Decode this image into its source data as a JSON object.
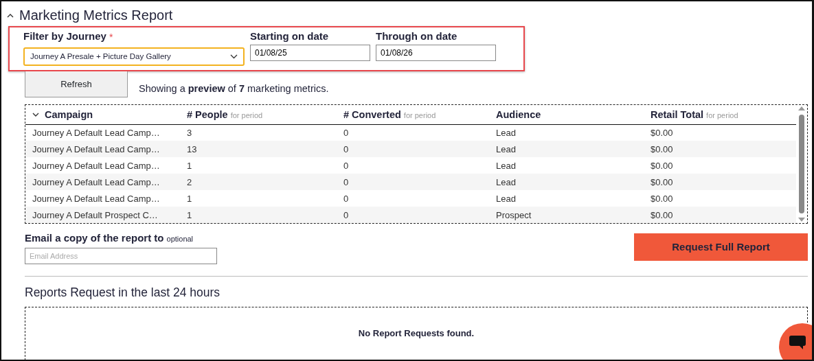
{
  "title": "Marketing Metrics Report",
  "filters": {
    "journey": {
      "label": "Filter by Journey",
      "required_mark": "*",
      "value": "Journey A Presale + Picture Day Gallery"
    },
    "start": {
      "label": "Starting on date",
      "value": "01/08/25"
    },
    "through": {
      "label": "Through on date",
      "value": "01/08/26"
    }
  },
  "refresh_button": "Refresh",
  "preview_text": "Showing a **preview** of **7** marketing metrics.",
  "table": {
    "columns": [
      {
        "label": "Campaign"
      },
      {
        "label": "# People",
        "note": "for period"
      },
      {
        "label": "# Converted",
        "note": "for period"
      },
      {
        "label": "Audience"
      },
      {
        "label": "Retail Total",
        "note": "for period"
      }
    ],
    "rows": [
      [
        "Journey A Default Lead Camp…",
        "3",
        "0",
        "Lead",
        "$0.00"
      ],
      [
        "Journey A Default Lead Camp…",
        "13",
        "0",
        "Lead",
        "$0.00"
      ],
      [
        "Journey A Default Lead Camp…",
        "1",
        "0",
        "Lead",
        "$0.00"
      ],
      [
        "Journey A Default Lead Camp…",
        "2",
        "0",
        "Lead",
        "$0.00"
      ],
      [
        "Journey A Default Lead Camp…",
        "1",
        "0",
        "Lead",
        "$0.00"
      ],
      [
        "Journey A Default Prospect C…",
        "1",
        "0",
        "Prospect",
        "$0.00"
      ]
    ]
  },
  "email": {
    "label": "Email a copy of the report to",
    "note": "optional",
    "placeholder": "Email Address"
  },
  "request_button": "Request Full Report",
  "requests": {
    "heading": "Reports Request in the last 24 hours",
    "empty_text": "No Report Requests found."
  }
}
